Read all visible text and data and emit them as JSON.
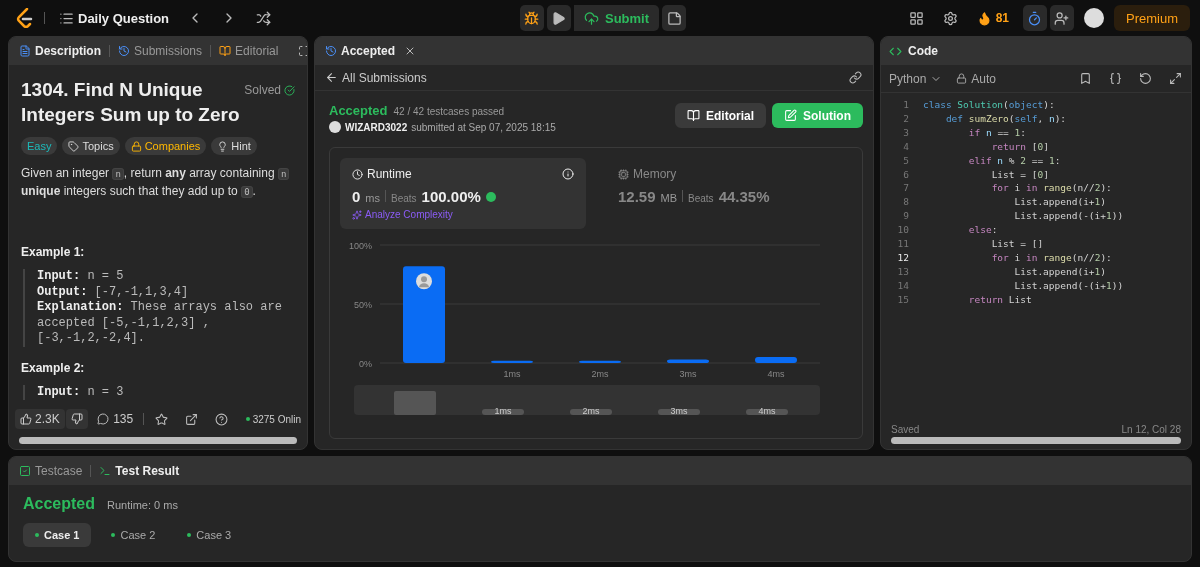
{
  "topbar": {
    "title": "Daily Question",
    "submit": "Submit",
    "streak": "81",
    "premium": "Premium"
  },
  "description_panel": {
    "tabs": [
      {
        "label": "Description",
        "kind": "description",
        "selected": true
      },
      {
        "label": "Submissions",
        "kind": "submissions",
        "selected": false
      },
      {
        "label": "Editorial",
        "kind": "editorial",
        "selected": false
      }
    ],
    "title": "1304. Find N Unique Integers Sum up to Zero",
    "status": "Solved",
    "tags": [
      {
        "label": "Easy",
        "kind": "difficulty"
      },
      {
        "label": "Topics",
        "kind": "topics"
      },
      {
        "label": "Companies",
        "kind": "companies"
      },
      {
        "label": "Hint",
        "kind": "hint"
      }
    ],
    "paragraph": [
      {
        "kind": "text",
        "text": "Given an integer "
      },
      {
        "kind": "code",
        "text": "n"
      },
      {
        "kind": "text",
        "text": ", return **any** array containing "
      },
      {
        "kind": "code",
        "text": "n"
      },
      {
        "kind": "text",
        "text": " **unique** integers such that they add up to "
      },
      {
        "kind": "code",
        "text": "0"
      },
      {
        "kind": "text",
        "text": "."
      }
    ],
    "examples": [
      {
        "heading": "Example 1:",
        "lines": [
          "**Input:** n = 5",
          "**Output:** [-7,-1,1,3,4]",
          "**Explanation:** These arrays also are",
          "accepted [-5,-1,1,2,3] ,",
          "[-3,-1,2,-2,4]."
        ]
      },
      {
        "heading": "Example 2:",
        "lines": [
          "**Input:** n = 3"
        ]
      }
    ],
    "footer": {
      "likes": "2.3K",
      "comments": "135",
      "online": "3275 Onlin"
    }
  },
  "submission_panel": {
    "tab": "Accepted",
    "back": "All Submissions",
    "status": "Accepted",
    "testcases": "42 / 42 testcases passed",
    "user": "WIZARD3022",
    "submitted": "submitted at Sep 07, 2025 18:15",
    "editorial_button": "Editorial",
    "solution_button": "Solution",
    "runtime": {
      "label": "Runtime",
      "value": "0",
      "unit": "ms",
      "beats_label": "Beats",
      "beats": "100.00%",
      "analyze": "Analyze Complexity"
    },
    "memory": {
      "label": "Memory",
      "value": "12.59",
      "unit": "MB",
      "beats_label": "Beats",
      "beats": "44.35%"
    },
    "chart_data": {
      "type": "bar",
      "categories": [
        null,
        "1ms",
        "2ms",
        "3ms",
        "4ms"
      ],
      "values": [
        82,
        2,
        2,
        3,
        5
      ],
      "ylim": [
        0,
        100
      ],
      "yticks": [
        {
          "value": 0,
          "label": "0%"
        },
        {
          "value": 50,
          "label": "50%"
        },
        {
          "value": 100,
          "label": "100%"
        }
      ]
    },
    "overview_labels": [
      "1ms",
      "2ms",
      "3ms",
      "4ms"
    ]
  },
  "code_panel": {
    "title": "Code",
    "language": "Python",
    "mode": "Auto",
    "saved": "Saved",
    "cursor": "Ln 12, Col 28",
    "lines": [
      {
        "no": "1",
        "current": false,
        "tokens": [
          {
            "kind": "kw",
            "text": "class "
          },
          {
            "kind": "cls",
            "text": "Solution"
          },
          {
            "kind": "p",
            "text": "("
          },
          {
            "kind": "kw",
            "text": "object"
          },
          {
            "kind": "p",
            "text": "):"
          }
        ]
      },
      {
        "no": "2",
        "current": false,
        "tokens": [
          {
            "kind": "kw",
            "text": "    def "
          },
          {
            "kind": "fn",
            "text": "sumZero"
          },
          {
            "kind": "p",
            "text": "("
          },
          {
            "kind": "kw",
            "text": "self"
          },
          {
            "kind": "p",
            "text": ", "
          },
          {
            "kind": "var",
            "text": "n"
          },
          {
            "kind": "p",
            "text": "):"
          }
        ]
      },
      {
        "no": "3",
        "current": false,
        "tokens": [
          {
            "kind": "ctl",
            "text": "        if "
          },
          {
            "kind": "var",
            "text": "n"
          },
          {
            "kind": "p",
            "text": " == "
          },
          {
            "kind": "num",
            "text": "1"
          },
          {
            "kind": "p",
            "text": ":"
          }
        ]
      },
      {
        "no": "4",
        "current": false,
        "tokens": [
          {
            "kind": "ctl",
            "text": "            return "
          },
          {
            "kind": "p",
            "text": "["
          },
          {
            "kind": "num",
            "text": "0"
          },
          {
            "kind": "p",
            "text": "]"
          }
        ]
      },
      {
        "no": "5",
        "current": false,
        "tokens": [
          {
            "kind": "ctl",
            "text": "        elif "
          },
          {
            "kind": "var",
            "text": "n"
          },
          {
            "kind": "p",
            "text": " % "
          },
          {
            "kind": "num",
            "text": "2"
          },
          {
            "kind": "p",
            "text": " == "
          },
          {
            "kind": "num",
            "text": "1"
          },
          {
            "kind": "p",
            "text": ":"
          }
        ]
      },
      {
        "no": "6",
        "current": false,
        "tokens": [
          {
            "kind": "p",
            "text": "            List = ["
          },
          {
            "kind": "num",
            "text": "0"
          },
          {
            "kind": "p",
            "text": "]"
          }
        ]
      },
      {
        "no": "7",
        "current": false,
        "tokens": [
          {
            "kind": "ctl",
            "text": "            for "
          },
          {
            "kind": "p",
            "text": "i "
          },
          {
            "kind": "ctl",
            "text": "in "
          },
          {
            "kind": "fn",
            "text": "range"
          },
          {
            "kind": "p",
            "text": "(n//"
          },
          {
            "kind": "num",
            "text": "2"
          },
          {
            "kind": "p",
            "text": "):"
          }
        ]
      },
      {
        "no": "8",
        "current": false,
        "tokens": [
          {
            "kind": "p",
            "text": "                List.append(i+"
          },
          {
            "kind": "num",
            "text": "1"
          },
          {
            "kind": "p",
            "text": ")"
          }
        ]
      },
      {
        "no": "9",
        "current": false,
        "tokens": [
          {
            "kind": "p",
            "text": "                List.append(-(i+"
          },
          {
            "kind": "num",
            "text": "1"
          },
          {
            "kind": "p",
            "text": "))"
          }
        ]
      },
      {
        "no": "10",
        "current": false,
        "tokens": [
          {
            "kind": "ctl",
            "text": "        else"
          },
          {
            "kind": "p",
            "text": ":"
          }
        ]
      },
      {
        "no": "11",
        "current": false,
        "tokens": [
          {
            "kind": "p",
            "text": "            List = []"
          }
        ]
      },
      {
        "no": "12",
        "current": true,
        "tokens": [
          {
            "kind": "ctl",
            "text": "            for "
          },
          {
            "kind": "p",
            "text": "i "
          },
          {
            "kind": "ctl",
            "text": "in "
          },
          {
            "kind": "fn",
            "text": "range"
          },
          {
            "kind": "p",
            "text": "(n//"
          },
          {
            "kind": "num",
            "text": "2"
          },
          {
            "kind": "p",
            "text": "):"
          }
        ]
      },
      {
        "no": "13",
        "current": false,
        "tokens": [
          {
            "kind": "p",
            "text": "                List.append(i+"
          },
          {
            "kind": "num",
            "text": "1"
          },
          {
            "kind": "p",
            "text": ")"
          }
        ]
      },
      {
        "no": "14",
        "current": false,
        "tokens": [
          {
            "kind": "p",
            "text": "                List.append(-(i+"
          },
          {
            "kind": "num",
            "text": "1"
          },
          {
            "kind": "p",
            "text": "))"
          }
        ]
      },
      {
        "no": "15",
        "current": false,
        "tokens": [
          {
            "kind": "ctl",
            "text": "        return "
          },
          {
            "kind": "p",
            "text": "List"
          }
        ]
      }
    ]
  },
  "result_panel": {
    "tabs": [
      {
        "label": "Testcase",
        "kind": "testcase",
        "selected": false
      },
      {
        "label": "Test Result",
        "kind": "result",
        "selected": true
      }
    ],
    "status": "Accepted",
    "runtime": "Runtime: 0 ms",
    "cases": [
      {
        "label": "Case 1",
        "selected": true
      },
      {
        "label": "Case 2",
        "selected": false
      },
      {
        "label": "Case 3",
        "selected": false
      }
    ]
  }
}
